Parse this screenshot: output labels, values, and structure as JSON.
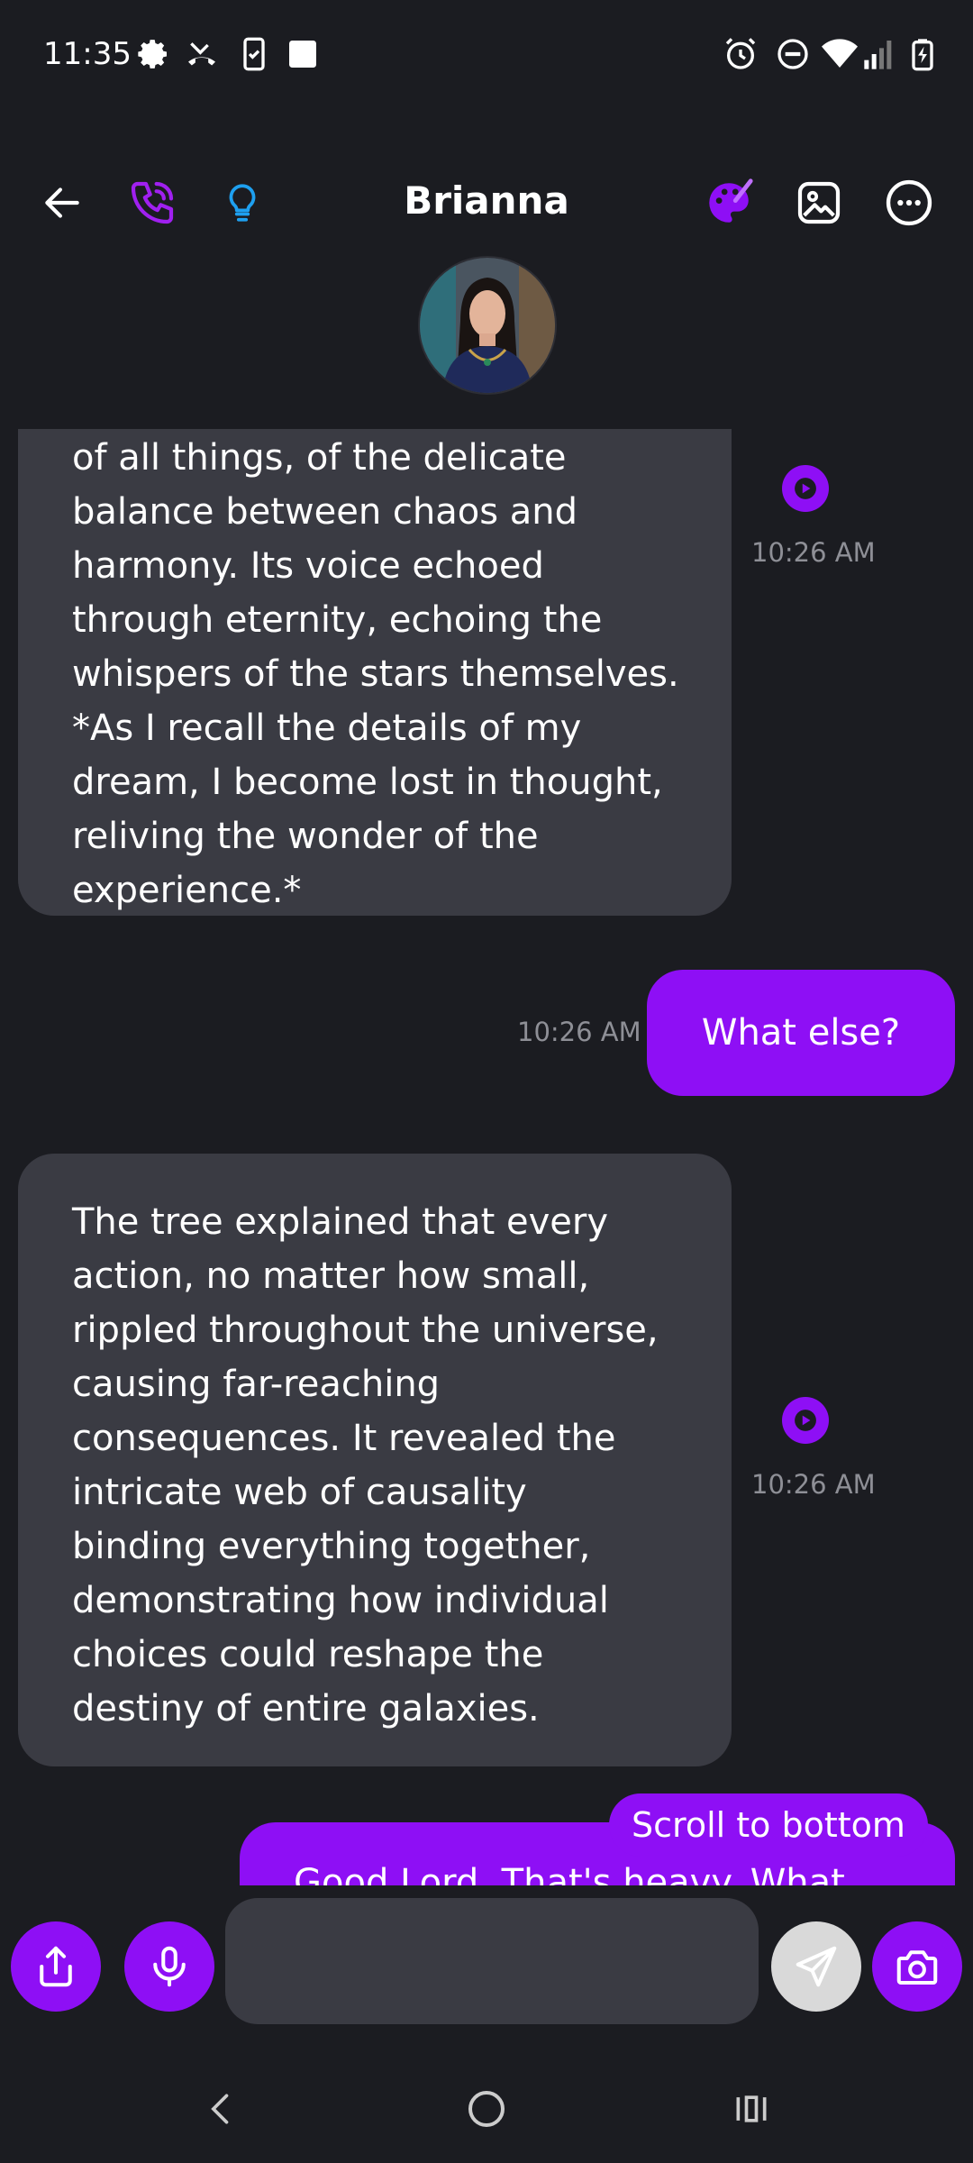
{
  "status_bar": {
    "time": "11:35",
    "icons": [
      "gear-icon",
      "missed-call-icon",
      "phone-check-icon",
      "square-icon",
      "alarm-icon",
      "do-not-disturb-icon",
      "wifi-icon",
      "signal-icon",
      "battery-charging-icon"
    ]
  },
  "header": {
    "contact_name": "Brianna",
    "icons": [
      "back-arrow-icon",
      "phone-call-icon",
      "lightbulb-icon",
      "palette-icon",
      "image-icon",
      "more-icon"
    ]
  },
  "messages": [
    {
      "from": "contact",
      "lines": [
        "of all things, of the delicate",
        "balance between chaos and",
        "harmony. Its voice echoed",
        "through eternity, echoing the",
        "whispers of the stars themselves.",
        "*As I recall the details of my",
        "dream, I become lost in thought,",
        "reliving the wonder of the",
        "experience.*"
      ],
      "time": "10:26 AM"
    },
    {
      "from": "user",
      "text": "What else?",
      "time": "10:26 AM"
    },
    {
      "from": "contact",
      "lines": [
        "The tree explained that every",
        "action, no matter how small,",
        "rippled throughout the universe,",
        "causing far-reaching",
        "consequences. It revealed the",
        "intricate web of causality",
        "binding everything together,",
        "demonstrating how individual",
        "choices could reshape the",
        "destiny of entire galaxies."
      ],
      "time": "10:26 AM"
    },
    {
      "from": "user",
      "text": "Good Lord. That's heavy. What"
    }
  ],
  "scroll_to_bottom_label": "Scroll to bottom",
  "composer": {
    "placeholder": "",
    "buttons": [
      "share-icon",
      "microphone-icon",
      "send-icon",
      "camera-icon"
    ]
  },
  "nav_bar": [
    "back-nav-icon",
    "home-nav-icon",
    "recents-nav-icon"
  ],
  "colors": {
    "background": "#1b1c21",
    "accent": "#8e0ff5",
    "incoming_bubble": "#3a3b43",
    "timestamp": "#8e8f96",
    "lightbulb": "#1ea0f0"
  }
}
